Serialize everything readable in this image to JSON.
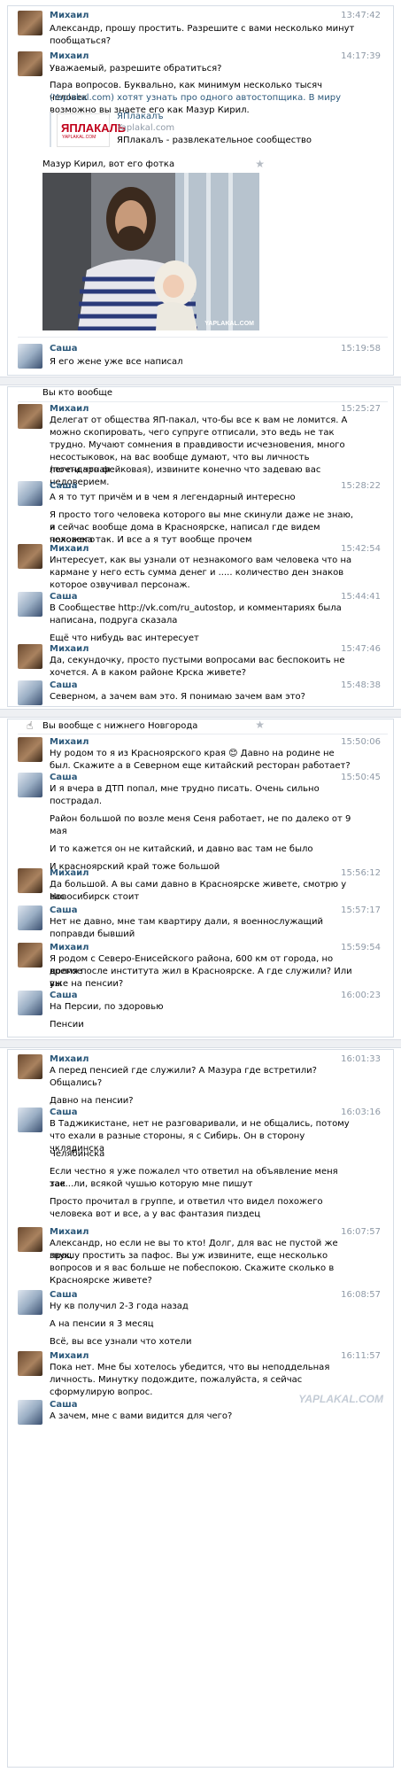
{
  "colors": {
    "name": "#2b587a",
    "time": "#8f9aa7",
    "link": "#2b587a"
  },
  "messages": [
    {
      "name": "Михаил",
      "time": "13:47:42",
      "lines": [
        "Александр, прошу простить. Разрешите с вами несколько минут",
        "пообщаться?"
      ]
    },
    {
      "name": "Михаил",
      "time": "14:17:39",
      "lines": [
        "Уважаемый, разрешите обратиться?",
        "",
        "Пара вопросов. Буквально, как минимум несколько тысяч человек",
        "(Yaplakal.com) хотят узнать про одного автостопщика. В миру",
        "возможно вы знаете его как Мазур Кирил."
      ]
    },
    {
      "name": "Саша",
      "time": "15:19:58",
      "lines": [
        "Я его жене уже все написал"
      ]
    }
  ],
  "link_card": {
    "logo_text": "ЯПЛАКАЛЬ",
    "logo_sub": "YAPLAKAL.COM",
    "title": "ЯПлакалъ",
    "domain": "Yaplakal.com",
    "desc": "ЯПлакалъ - развлекательное сообщество"
  },
  "photo_caption": "Мазур Кирил, вот его фотка",
  "photo_watermark": "YAPLAKAL.COM",
  "s2": {
    "intro": "Вы кто вообще",
    "messages": [
      {
        "name": "Михаил",
        "time": "15:25:27",
        "lines": [
          "Делегат от общества ЯП-пакал, что-бы все к вам не ломится. А",
          "можно скопировать, чего супруге отписали, это ведь не так",
          "трудно. Мучают сомнения в правдивости исчезновения, много",
          "несостыковок, на вас вообще думают, что вы личность легендарная",
          "(почти что фейковая), извините конечно что задеваю вас",
          "недоверием."
        ]
      },
      {
        "name": "Саша",
        "time": "15:28:22",
        "lines": [
          "А я то тут причём и в чем я легендарный интересно",
          "",
          "Я просто того человека которого вы мне скинули даже не знаю, и",
          "я сейчас вообще дома в Красноярске, написал где видем похожего",
          "человека так. И все а я тут вообще прочем"
        ]
      },
      {
        "name": "Михаил",
        "time": "15:42:54",
        "lines": [
          "Интересует, как вы узнали от незнакомого вам человека что на",
          "кармане у него есть сумма денег и ..... количество ден знаков",
          "которое озвучивал персонаж."
        ]
      },
      {
        "name": "Саша",
        "time": "15:44:41",
        "lines": [
          "В Сообществе http://vk.com/ru_autostop, и комментариях была",
          "написана, подруга сказала",
          "",
          "Ещё что нибудь вас интересует"
        ]
      },
      {
        "name": "Михаил",
        "time": "15:47:46",
        "lines": [
          "Да, секундочку, просто пустыми вопросами вас беспокоить не",
          "хочется. А в каком районе Крска живете?"
        ]
      },
      {
        "name": "Саша",
        "time": "15:48:38",
        "lines": [
          "Северном, а зачем вам это. Я понимаю зачем вам это?"
        ]
      }
    ]
  },
  "s3": {
    "intro": "Вы вообще с нижнего Новгорода",
    "messages": [
      {
        "name": "Михаил",
        "time": "15:50:06",
        "lines": [
          "Ну родом то я из Красноярского края 😊 Давно на родине не",
          "был. Скажите а в Северном еще китайский ресторан работает?"
        ]
      },
      {
        "name": "Саша",
        "time": "15:50:45",
        "lines": [
          "И я вчера в ДТП попал, мне трудно писать. Очень сильно",
          "пострадал.",
          "",
          "Район большой по возле меня Сеня работает, не по далеко от 9",
          "мая",
          "",
          "И то кажется он не китайский, и давно вас там не было",
          "",
          "И красноярский край тоже большой"
        ]
      },
      {
        "name": "Михаил",
        "time": "15:56:12",
        "lines": [
          "Да большой. А вы сами давно в Красноярске живете, смотрю у вас",
          "Новосибирск стоит"
        ]
      },
      {
        "name": "Саша",
        "time": "15:57:17",
        "lines": [
          "Нет не давно, мне там квартиру дали, я военнослужащий",
          "поправди бывший"
        ]
      },
      {
        "name": "Михаил",
        "time": "15:59:54",
        "lines": [
          "Я родом с Северо-Енисейского района, 600 км от города, но долгое",
          "время после института жил в Красноярске. А где служили? Или вы",
          "уже на пенсии?"
        ]
      },
      {
        "name": "Саша",
        "time": "16:00:23",
        "lines": [
          "На Персии, по здоровью",
          "",
          "Пенсии"
        ]
      }
    ]
  },
  "s4": {
    "messages": [
      {
        "name": "Михаил",
        "time": "16:01:33",
        "lines": [
          "А перед пенсией где служили? А Мазура где встретили?",
          "Общались?",
          "",
          "Давно на пенсии?"
        ]
      },
      {
        "name": "Саша",
        "time": "16:03:16",
        "lines": [
          "В Таджикистане, нет не разговаривали, и не общались, потому",
          "что ехали в разные стороны, я с Сибирь. Он в сторону чклядинска",
          "",
          "Челябинска",
          "",
          "Если честно я уже пожалел что ответил на объявление меня так",
          "зае...ли, всякой чушью которую мне пишут",
          "",
          "Просто прочитал в группе, и ответил что видел похожего",
          "человека вот и все, а у вас фантазия пиздец"
        ]
      },
      {
        "name": "Михаил",
        "time": "16:07:57",
        "lines": [
          "Александр, но если не вы то кто! Долг, для вас не пустой же звук,",
          "прошу простить за пафос. Вы уж извините, еще несколько",
          "вопросов и я вас больше не побеспокою. Скажите сколько в",
          "Красноярске живете?"
        ]
      },
      {
        "name": "Саша",
        "time": "16:08:57",
        "lines": [
          "Ну кв получил 2-3 года назад",
          "",
          "А на пенсии я 3 месяц",
          "",
          "Всё, вы все узнали что хотели"
        ]
      },
      {
        "name": "Михаил",
        "time": "16:11:57",
        "lines": [
          "Пока нет. Мне бы хотелось убедится, что вы неподдельная",
          "личность. Минутку подождите, пожалуйста, я сейчас",
          "сформулирую вопрос."
        ]
      },
      {
        "name": "Саша",
        "time": "",
        "lines": [
          "А зачем, мне с вами видится для чего?"
        ]
      }
    ],
    "watermark": "YAPLAKAL.COM"
  }
}
